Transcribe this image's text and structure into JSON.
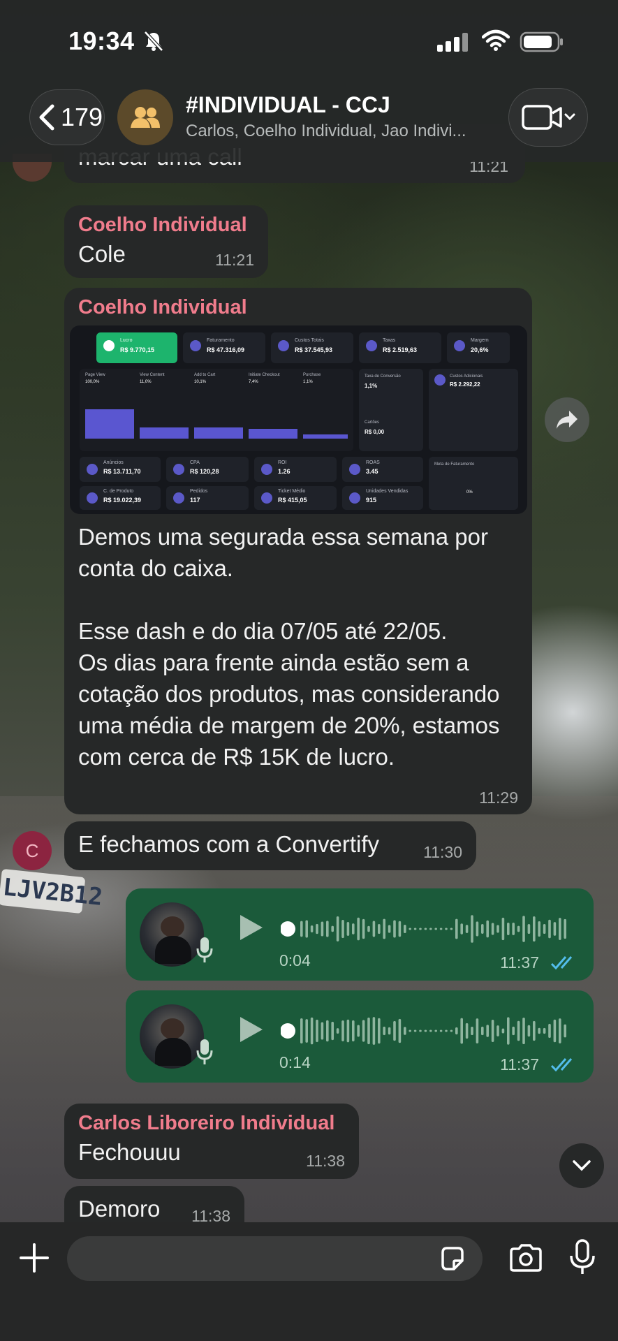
{
  "status_bar": {
    "time": "19:34"
  },
  "header": {
    "back_count": "179",
    "title": "#INDIVIDUAL - CCJ",
    "subtitle": "Carlos, Coelho Individual, Jao Indivi..."
  },
  "messages": [
    {
      "id": "m0",
      "text": "marcar uma call",
      "time": "11:21"
    },
    {
      "id": "m1",
      "sender": "Coelho Individual",
      "text": "Cole",
      "time": "11:21"
    },
    {
      "id": "m2",
      "sender": "Coelho Individual",
      "text": "Demos uma segurada essa semana por conta do caixa.\n\nEsse dash e do dia 07/05 até 22/05.\nOs dias para frente ainda estão sem a cotação dos produtos, mas considerando uma média de margem de 20%, estamos com cerca de R$ 15K de lucro.",
      "time": "11:29"
    },
    {
      "id": "m3",
      "avatar_letter": "C",
      "text": "E fechamos com a Convertify",
      "time": "11:30"
    },
    {
      "id": "m4",
      "type": "audio",
      "duration": "0:04",
      "time": "11:37"
    },
    {
      "id": "m5",
      "type": "audio",
      "duration": "0:14",
      "time": "11:37"
    },
    {
      "id": "m6",
      "sender": "Carlos Liboreiro Individual",
      "text": "Fechouuu",
      "time": "11:38"
    },
    {
      "id": "m7",
      "text": "Demoro",
      "time": "11:38"
    }
  ],
  "dashboard": {
    "cards_row1": [
      {
        "label": "Lucro",
        "value": "R$ 9.770,15"
      },
      {
        "label": "Faturamento",
        "value": "R$ 47.316,09"
      },
      {
        "label": "Custos Totais",
        "value": "R$ 37.545,93"
      },
      {
        "label": "Taxas",
        "value": "R$ 2.519,63"
      },
      {
        "label": "Margem",
        "value": "20,6%"
      }
    ],
    "funnel_labels": [
      "Page View",
      "View Content",
      "Add to Cart",
      "Initiate Checkout",
      "Purchase"
    ],
    "funnel_values": [
      "100,0%",
      "11,0%",
      "10,1%",
      "7,4%",
      "1,1%"
    ],
    "conversion": {
      "label": "Taxa de Conversão",
      "value": "1,1%"
    },
    "chargeback": {
      "label": "Cartões",
      "value": "R$ 0,00"
    },
    "extra_costs": {
      "label": "Custos Adicionais",
      "value": "R$ 2.292,22"
    },
    "cards_row2": [
      {
        "label": "Anúncios",
        "value": "R$ 13.711,70"
      },
      {
        "label": "CPA",
        "value": "R$ 120,28"
      },
      {
        "label": "ROI",
        "value": "1.26"
      },
      {
        "label": "ROAS",
        "value": "3.45"
      }
    ],
    "cards_row3": [
      {
        "label": "C. de Produto",
        "value": "R$ 19.022,39"
      },
      {
        "label": "Pedidos",
        "value": "117"
      },
      {
        "label": "Ticket Médio",
        "value": "R$ 415,05"
      },
      {
        "label": "Unidades Vendidas",
        "value": "915"
      }
    ],
    "billing_mix": {
      "label": "Meta de Faturamento",
      "value": "0%"
    }
  },
  "input": {
    "placeholder": ""
  },
  "colors": {
    "sender_name": "#f07c8c",
    "bubble_in": "#262828",
    "bubble_out": "#1b5a3a",
    "read_check": "#53bdeb"
  },
  "icons": [
    "back-chevron-icon",
    "group-icon",
    "video-call-icon",
    "share-icon",
    "play-icon",
    "mic-icon",
    "chevron-down-icon",
    "plus-icon",
    "sticker-icon",
    "camera-icon"
  ]
}
